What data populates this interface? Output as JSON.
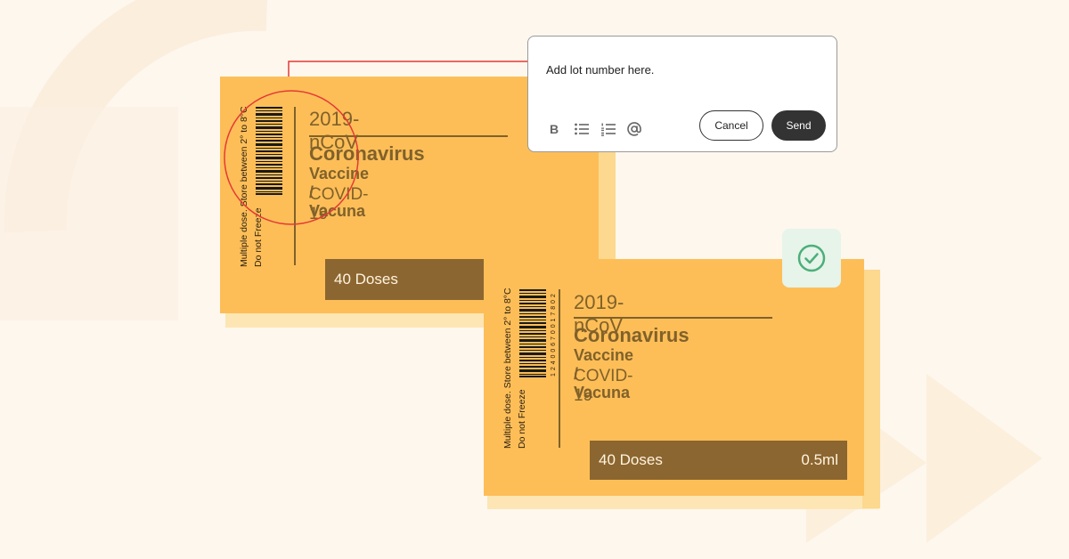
{
  "colors": {
    "background": "#fef7ee",
    "box_face": "#fdbe58",
    "box_text": "#80612a",
    "dose_bar": "#8c6630",
    "highlight": "#e53935",
    "check": "#4caf7a",
    "send_button": "#333333"
  },
  "box_back": {
    "side_text_1": "Multiple dose. Store between 2° to  8°C",
    "side_text_2": "Do not Freeze",
    "code": "2019-nCoV",
    "name": "Coronavirus",
    "vaccine": "Vaccine / Vacuna",
    "disease": "COVID-19",
    "doses": "40 Doses"
  },
  "box_front": {
    "side_text_1": "Multiple dose. Store between 2° to  8°C",
    "side_text_2": "Do not Freeze",
    "barcode_number": "1 2 4 0 0 6 7 0 0 1 7 8 0 2",
    "code": "2019-nCoV",
    "name": "Coronavirus",
    "vaccine": "Vaccine / Vacuna",
    "disease": "COVID-19",
    "doses": "40 Doses",
    "volume": "0.5ml"
  },
  "comment": {
    "text": "Add lot number here.",
    "tools": {
      "bold": "B",
      "bullets_icon": "bulleted-list-icon",
      "numbered_icon": "numbered-list-icon",
      "mention_icon": "at-mention-icon"
    },
    "cancel_label": "Cancel",
    "send_label": "Send"
  },
  "status_icon": "check-circle-icon"
}
